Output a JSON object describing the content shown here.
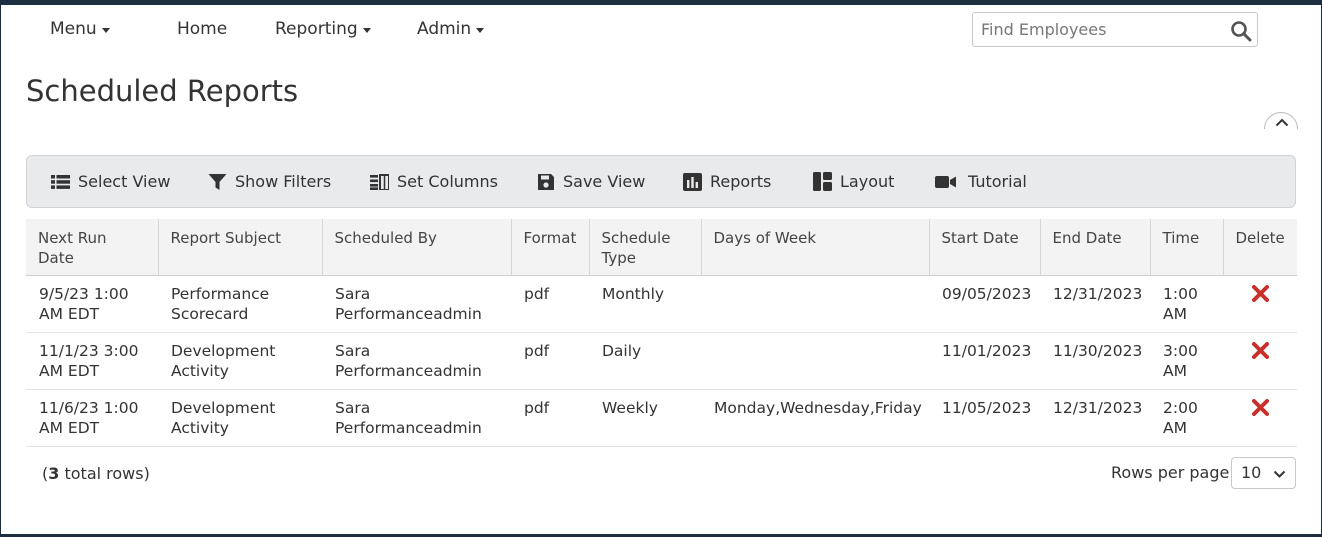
{
  "nav": {
    "menu": "Menu",
    "home": "Home",
    "reporting": "Reporting",
    "admin": "Admin"
  },
  "search": {
    "placeholder": "Find Employees",
    "value": ""
  },
  "page": {
    "title": "Scheduled Reports"
  },
  "toolbar": {
    "select_view": "Select View",
    "show_filters": "Show Filters",
    "set_columns": "Set Columns",
    "save_view": "Save View",
    "reports": "Reports",
    "layout": "Layout",
    "tutorial": "Tutorial"
  },
  "table": {
    "headers": {
      "next_run": "Next Run Date",
      "subject": "Report Subject",
      "scheduled_by": "Scheduled By",
      "format": "Format",
      "schedule_type": "Schedule Type",
      "days": "Days of Week",
      "start": "Start Date",
      "end": "End Date",
      "time": "Time",
      "delete": "Delete"
    },
    "rows": [
      {
        "next_run": "9/5/23 1:00 AM EDT",
        "subject": "Performance Scorecard",
        "scheduled_by": "Sara Performanceadmin",
        "format": "pdf",
        "schedule_type": "Monthly",
        "days": "",
        "start": "09/05/2023",
        "end": "12/31/2023",
        "time": "1:00 AM"
      },
      {
        "next_run": "11/1/23 3:00 AM EDT",
        "subject": "Development Activity",
        "scheduled_by": "Sara Performanceadmin",
        "format": "pdf",
        "schedule_type": "Daily",
        "days": "",
        "start": "11/01/2023",
        "end": "11/30/2023",
        "time": "3:00 AM"
      },
      {
        "next_run": "11/6/23 1:00 AM EDT",
        "subject": "Development Activity",
        "scheduled_by": "Sara Performanceadmin",
        "format": "pdf",
        "schedule_type": "Weekly",
        "days": "Monday,Wednesday,Friday",
        "start": "11/05/2023",
        "end": "12/31/2023",
        "time": "2:00 AM"
      }
    ]
  },
  "footer": {
    "count_open": "(",
    "count": "3",
    "count_suffix": " total rows)",
    "rows_per_page_label": "Rows per page:",
    "rows_per_page_value": "10"
  },
  "colors": {
    "frame": "#1c2e40",
    "toolbar_bg": "#e8eaec",
    "delete_icon": "#c9302c"
  },
  "icons": {
    "search": "search-icon",
    "collapse": "chevron-up-icon",
    "select_view": "list-icon",
    "show_filters": "filter-icon",
    "set_columns": "columns-icon",
    "save_view": "floppy-disk-icon",
    "reports": "bar-chart-icon",
    "layout": "layout-icon",
    "tutorial": "video-camera-icon",
    "delete": "close-icon",
    "dropdown": "chevron-down-icon"
  }
}
